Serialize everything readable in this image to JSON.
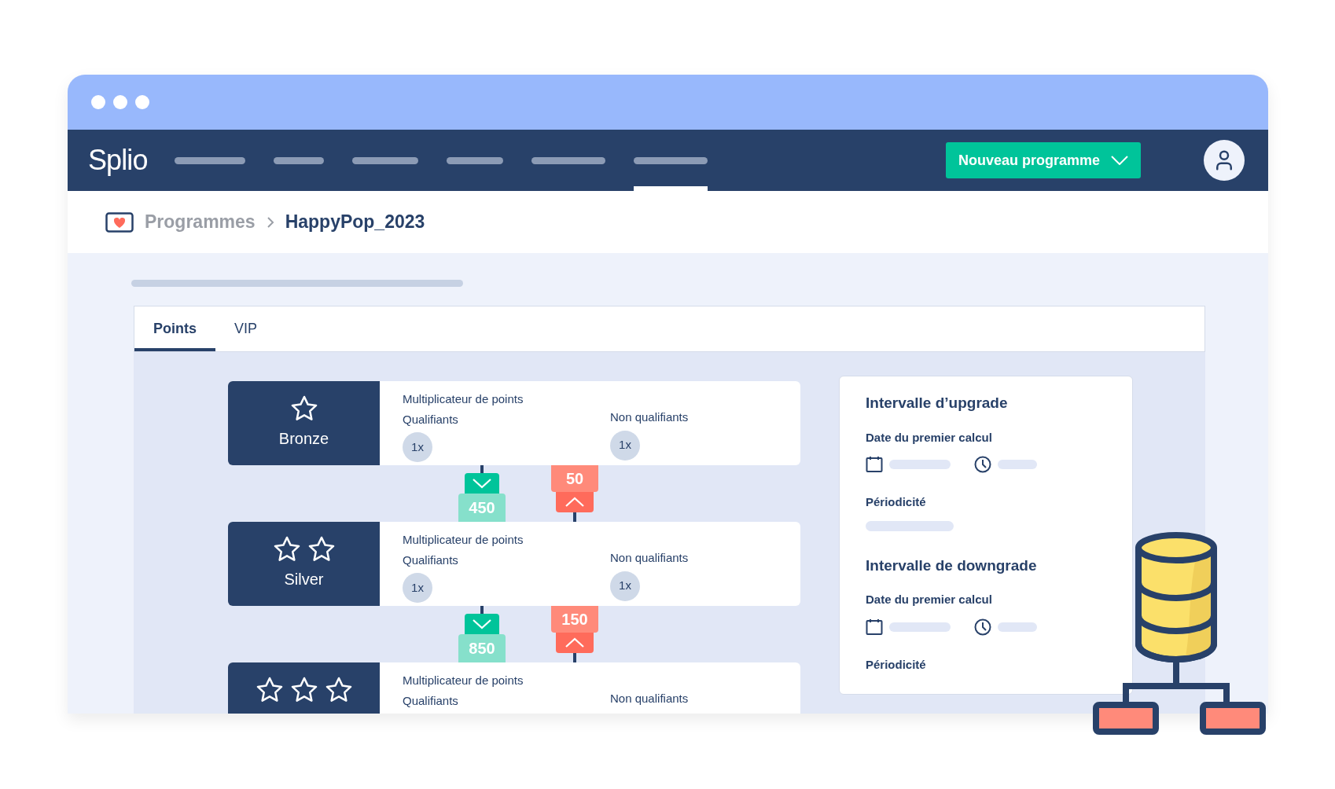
{
  "nav": {
    "logo": "Splio",
    "items": [
      {
        "selected": false
      },
      {
        "selected": false
      },
      {
        "selected": false
      },
      {
        "selected": false
      },
      {
        "selected": false
      },
      {
        "selected": true
      }
    ],
    "primary_button": "Nouveau programme"
  },
  "breadcrumb": [
    "Programmes",
    "HappyPop_2023"
  ],
  "tabs": [
    {
      "label": "Points",
      "selected": true
    },
    {
      "label": "VIP",
      "selected": false
    }
  ],
  "tiers": [
    {
      "name": "Bronze",
      "badge_icons": [
        {
          "kind": "star"
        }
      ],
      "heading": "Multiplicateur de points",
      "qualifying_label": "Qualifiants",
      "qualifying_value": "1x",
      "non_qualifying_label": "Non qualifiants",
      "non_qualifying_value": "1x"
    },
    {
      "name": "Silver",
      "badge_icons": [
        {
          "kind": "star"
        },
        {
          "kind": "star"
        }
      ],
      "heading": "Multiplicateur de points",
      "qualifying_label": "Qualifiants",
      "qualifying_value": "1x",
      "non_qualifying_label": "Non qualifiants",
      "non_qualifying_value": "1x"
    },
    {
      "badge_icons": [
        {
          "kind": "star"
        },
        {
          "kind": "star"
        },
        {
          "kind": "star"
        }
      ],
      "heading": "Multiplicateur de points",
      "qualifying_label": "Qualifiants",
      "non_qualifying_label": "Non qualifiants"
    }
  ],
  "thresholds": [
    {
      "downgrade": "450",
      "upgrade": "50"
    },
    {
      "downgrade": "850",
      "upgrade": "150"
    }
  ],
  "intervals": [
    {
      "title": "Intervalle d’upgrade",
      "date_label": "Date du premier calcul",
      "period_label": "Périodicité"
    },
    {
      "title": "Intervalle de downgrade",
      "date_label": "Date du premier calcul",
      "period_label": "Périodicité"
    }
  ]
}
